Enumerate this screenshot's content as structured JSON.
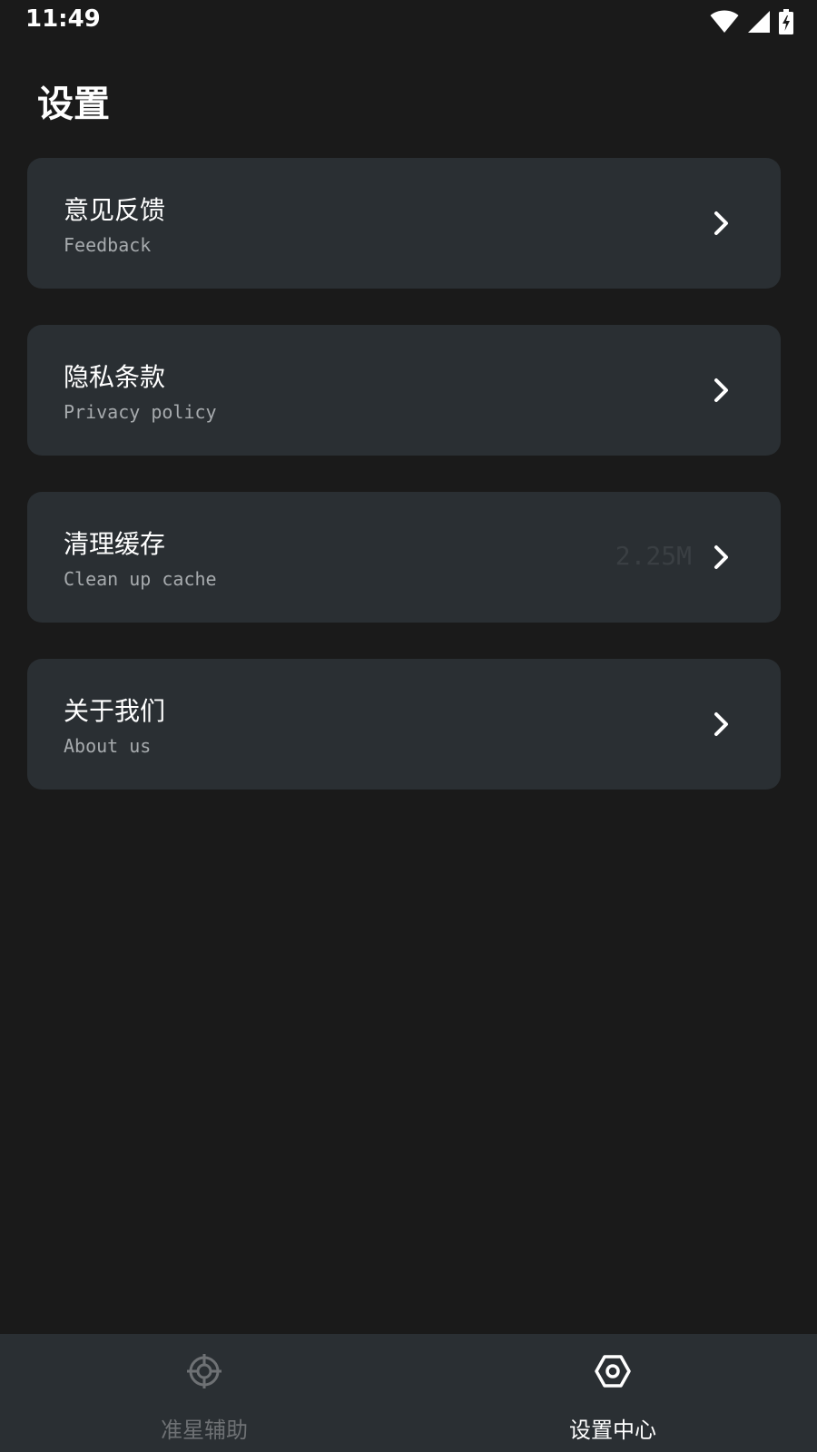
{
  "status_bar": {
    "time": "11:49",
    "icons": [
      "wifi-icon",
      "signal-icon",
      "battery-charging-icon"
    ]
  },
  "header": {
    "title": "设置"
  },
  "settings": {
    "items": [
      {
        "title": "意见反馈",
        "subtitle": "Feedback",
        "value": "",
        "icon": "chevron-right-icon"
      },
      {
        "title": "隐私条款",
        "subtitle": "Privacy policy",
        "value": "",
        "icon": "chevron-right-icon"
      },
      {
        "title": "清理缓存",
        "subtitle": "Clean up cache",
        "value": "2.25M",
        "icon": "chevron-right-icon"
      },
      {
        "title": "关于我们",
        "subtitle": "About us",
        "value": "",
        "icon": "chevron-right-icon"
      }
    ]
  },
  "bottom_nav": {
    "items": [
      {
        "label": "准星辅助",
        "icon": "crosshair-icon",
        "active": false
      },
      {
        "label": "设置中心",
        "icon": "hex-nut-icon",
        "active": true
      }
    ],
    "colors": {
      "active": "#ffffff",
      "inactive": "#6e7174"
    }
  },
  "colors": {
    "background": "#1a1a1a",
    "card": "#2a2f33",
    "subtitle": "#a7abae"
  }
}
